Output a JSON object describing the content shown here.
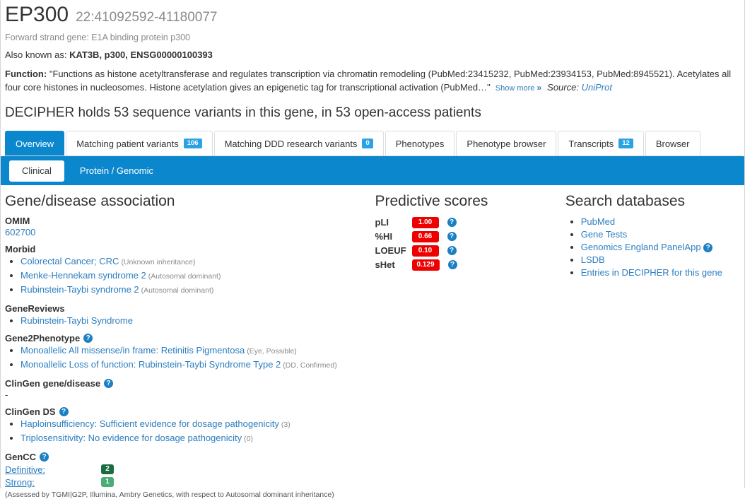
{
  "gene": {
    "symbol": "EP300",
    "locus": "22:41092592-41180077",
    "strand_line": "Forward strand gene: E1A binding protein p300",
    "aka_label": "Also known as:",
    "aka_value": "KAT3B, p300, ENSG00000100393",
    "function_label": "Function:",
    "function_text": "\"Functions as histone acetyltransferase and regulates transcription via chromatin remodeling (PubMed:23415232, PubMed:23934153, PubMed:8945521). Acetylates all four core histones in nucleosomes. Histone acetylation gives an epigenetic tag for transcriptional activation (PubMed…\"",
    "show_more": "Show more",
    "show_more_chevron": "»",
    "source_label": "Source:",
    "source_name": "UniProt",
    "summary": "DECIPHER holds 53 sequence variants in this gene, in 53 open-access patients"
  },
  "tabs": [
    {
      "label": "Overview",
      "badge": null,
      "active": true
    },
    {
      "label": "Matching patient variants",
      "badge": "106",
      "active": false
    },
    {
      "label": "Matching DDD research variants",
      "badge": "0",
      "active": false
    },
    {
      "label": "Phenotypes",
      "badge": null,
      "active": false
    },
    {
      "label": "Phenotype browser",
      "badge": null,
      "active": false
    },
    {
      "label": "Transcripts",
      "badge": "12",
      "active": false
    },
    {
      "label": "Browser",
      "badge": null,
      "active": false
    }
  ],
  "subtabs": [
    {
      "label": "Clinical",
      "active": true
    },
    {
      "label": "Protein / Genomic",
      "active": false
    }
  ],
  "gene_disease": {
    "heading": "Gene/disease association",
    "omim": {
      "title": "OMIM",
      "id": "602700"
    },
    "morbid": {
      "title": "Morbid",
      "items": [
        {
          "name": "Colorectal Cancer; CRC",
          "note": "(Unknown inheritance)"
        },
        {
          "name": "Menke-Hennekam syndrome 2",
          "note": "(Autosomal dominant)"
        },
        {
          "name": "Rubinstein-Taybi syndrome 2",
          "note": "(Autosomal dominant)"
        }
      ]
    },
    "genereviews": {
      "title": "GeneReviews",
      "items": [
        {
          "name": "Rubinstein-Taybi Syndrome",
          "note": ""
        }
      ]
    },
    "gene2phenotype": {
      "title": "Gene2Phenotype",
      "items": [
        {
          "name": "Monoallelic All missense/in frame: Retinitis Pigmentosa",
          "note": "(Eye, Possible)"
        },
        {
          "name": "Monoallelic Loss of function: Rubinstein-Taybi Syndrome Type 2",
          "note": "(DD, Confirmed)"
        }
      ]
    },
    "clingen_gene_disease": {
      "title": "ClinGen gene/disease",
      "value": "-"
    },
    "clingen_ds": {
      "title": "ClinGen DS",
      "items": [
        {
          "name": "Haploinsufficiency: Sufficient evidence for dosage pathogenicity",
          "note": "(3)"
        },
        {
          "name": "Triplosensitivity: No evidence for dosage pathogenicity",
          "note": "(0)"
        }
      ]
    },
    "gencc": {
      "title": "GenCC",
      "rows": [
        {
          "label": "Definitive:",
          "count": "2",
          "color": "#1b6b43"
        },
        {
          "label": "Strong:",
          "count": "1",
          "color": "#4aac77"
        }
      ],
      "note": "(Assessed by TGMI|G2P, Illumina, Ambry Genetics, with respect to Autosomal dominant inheritance)"
    }
  },
  "predictive_scores": {
    "heading": "Predictive scores",
    "badge_color": "#ee0000",
    "rows": [
      {
        "name": "pLI",
        "value": "1.00"
      },
      {
        "name": "%HI",
        "value": "0.66"
      },
      {
        "name": "LOEUF",
        "value": "0.10"
      },
      {
        "name": "sHet",
        "value": "0.129"
      }
    ]
  },
  "search_databases": {
    "heading": "Search databases",
    "items": [
      {
        "label": "PubMed",
        "help": false
      },
      {
        "label": "Gene Tests",
        "help": false
      },
      {
        "label": "Genomics England PanelApp",
        "help": true
      },
      {
        "label": "LSDB",
        "help": false
      },
      {
        "label": "Entries in DECIPHER for this gene",
        "help": false
      }
    ]
  },
  "icons": {
    "help": "?",
    "chevron_double_right": "»"
  },
  "colors": {
    "accent_blue": "#0b87ce",
    "link_blue": "#2b7dbf",
    "badge_blue": "#29a3e3",
    "score_red": "#ee0000"
  }
}
